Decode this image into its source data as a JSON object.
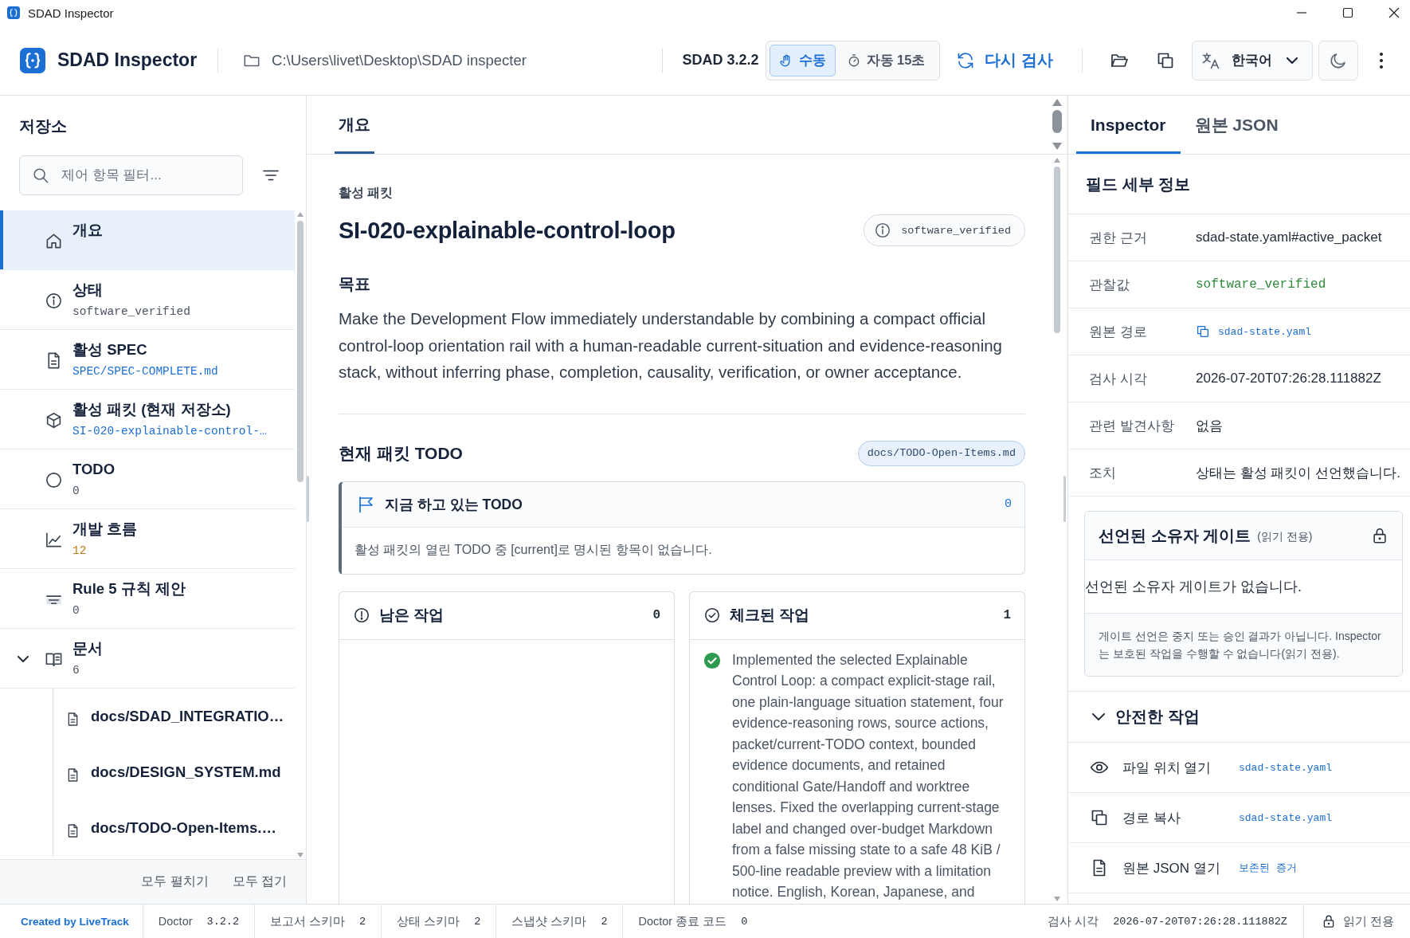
{
  "window": {
    "title": "SDAD Inspector"
  },
  "header": {
    "app_name": "SDAD Inspector",
    "path": "C:\\Users\\livet\\Desktop\\SDAD inspecter",
    "version": "SDAD 3.2.2",
    "mode_toggle": [
      {
        "kind": "manual",
        "label": "수동",
        "selected": true
      },
      {
        "kind": "auto",
        "label": "자동 15초",
        "selected": false
      }
    ],
    "rescan_button": "다시 검사",
    "language": "한국어"
  },
  "sidebar": {
    "title": "저장소",
    "filter": {
      "placeholder": "제어 항목 필터..."
    },
    "items": [
      {
        "kind": "overview",
        "label": "개요",
        "selected": true
      },
      {
        "kind": "status",
        "label": "상태",
        "value": "software_verified",
        "color": "#4b5563",
        "selected": false
      },
      {
        "kind": "spec",
        "label": "활성 SPEC",
        "value": "SPEC/SPEC-COMPLETE.md",
        "color": "#1b6fd4",
        "selected": false
      },
      {
        "kind": "packet",
        "label": "활성 패킷 (현재 저장소)",
        "value": "SI-020-explainable-control-…",
        "color": "#1b6fd4",
        "selected": false
      },
      {
        "kind": "todo",
        "label": "TODO",
        "value": "0",
        "color": "#4b5563",
        "selected": false
      },
      {
        "kind": "flow",
        "label": "개발 흐름",
        "value": "12",
        "color": "#c27a12",
        "selected": false
      },
      {
        "kind": "rules",
        "label": "Rule 5 규칙 제안",
        "value": "0",
        "color": "#4b5563",
        "selected": false
      },
      {
        "kind": "docs",
        "label": "문서",
        "value": "6",
        "color": "#4b5563",
        "selected": false,
        "expanded": true,
        "children": [
          {
            "label": "docs/SDAD_INTEGRATIO…",
            "selected": false
          },
          {
            "label": "docs/DESIGN_SYSTEM.md",
            "selected": false
          },
          {
            "label": "docs/TODO-Open-Items.…",
            "selected": false
          }
        ]
      }
    ],
    "footer_buttons": [
      "모두 펼치기",
      "모두 접기"
    ]
  },
  "main": {
    "tabs": [
      {
        "label": "개요",
        "selected": true
      }
    ],
    "eyebrow": "활성 패킷",
    "title": "SI-020-explainable-control-loop",
    "state_badge": "software_verified",
    "goal_heading": "목표",
    "goal_text": "Make the Development Flow immediately understandable by combining a compact official control-loop orientation rail with a human-readable current-situation and evidence-reasoning stack, without inferring phase, completion, causality, verification, or owner acceptance.",
    "todo_section": {
      "heading": "현재 패킷 TODO",
      "source": "docs/TODO-Open-Items.md",
      "current": {
        "title": "지금 하고 있는 TODO",
        "count": "0",
        "empty_text": "활성 패킷의 열린 TODO 중 [current]로 명시된 항목이 없습니다."
      },
      "remaining": {
        "title": "남은 작업",
        "count": "0"
      },
      "checked": {
        "title": "체크된 작업",
        "count": "1",
        "items": [
          {
            "text": "Implemented the selected Explainable Control Loop: a compact explicit-stage rail, one plain-language situation statement, four evidence-reasoning rows, source actions, packet/current-TODO context, bounded evidence documents, and retained conditional Gate/Handoff and worktree lenses. Fixed the overlapping current-stage label and changed over-budget Markdown from a false missing state to a safe 48 KiB / 500-line readable preview with a limitation notice. English, Korean, Japanese, and",
            "checked": true
          }
        ]
      }
    }
  },
  "inspector": {
    "tabs": [
      {
        "label": "Inspector",
        "selected": true
      },
      {
        "label": "원본 JSON",
        "selected": false
      }
    ],
    "heading": "필드 세부 정보",
    "fields": [
      {
        "kind": "text",
        "label": "권한 근거",
        "value": "sdad-state.yaml#active_packet"
      },
      {
        "kind": "code",
        "label": "관찰값",
        "value": "software_verified"
      },
      {
        "kind": "link",
        "label": "원본 경로",
        "value": "sdad-state.yaml"
      },
      {
        "kind": "text",
        "label": "검사 시각",
        "value": "2026-07-20T07:26:28.111882Z"
      },
      {
        "kind": "text",
        "label": "관련 발견사항",
        "value": "없음"
      },
      {
        "kind": "text",
        "label": "조치",
        "value": "상태는 활성 패킷이 선언했습니다."
      }
    ],
    "owner_gate": {
      "title": "선언된 소유자 게이트",
      "note": "(읽기 전용)",
      "empty_text": "선언된 소유자 게이트가 없습니다.",
      "disclaimer": "게이트 선언은 중지 또는 승인 결과가 아닙니다. Inspector 는 보호된 작업을 수행할 수 없습니다(읽기 전용)."
    },
    "safe_actions": {
      "title": "안전한 작업",
      "expanded": true,
      "items": [
        {
          "kind": "reveal",
          "label": "파일 위치 열기",
          "target": "sdad-state.yaml"
        },
        {
          "kind": "copy",
          "label": "경로 복사",
          "target": "sdad-state.yaml"
        },
        {
          "kind": "open",
          "label": "원본 JSON 열기",
          "target": "보존된 증거"
        }
      ]
    }
  },
  "status_bar": {
    "credit": "Created by LiveTrack",
    "items": [
      {
        "label": "Doctor",
        "value": "3.2.2"
      },
      {
        "label": "보고서 스키마",
        "value": "2"
      },
      {
        "label": "상태 스키마",
        "value": "2"
      },
      {
        "label": "스냅샷 스키마",
        "value": "2"
      },
      {
        "label": "Doctor 종료 코드",
        "value": "0"
      }
    ],
    "scan_time": {
      "label": "검사 시각",
      "value": "2026-07-20T07:26:28.111882Z"
    },
    "mode": "읽기 전용"
  }
}
